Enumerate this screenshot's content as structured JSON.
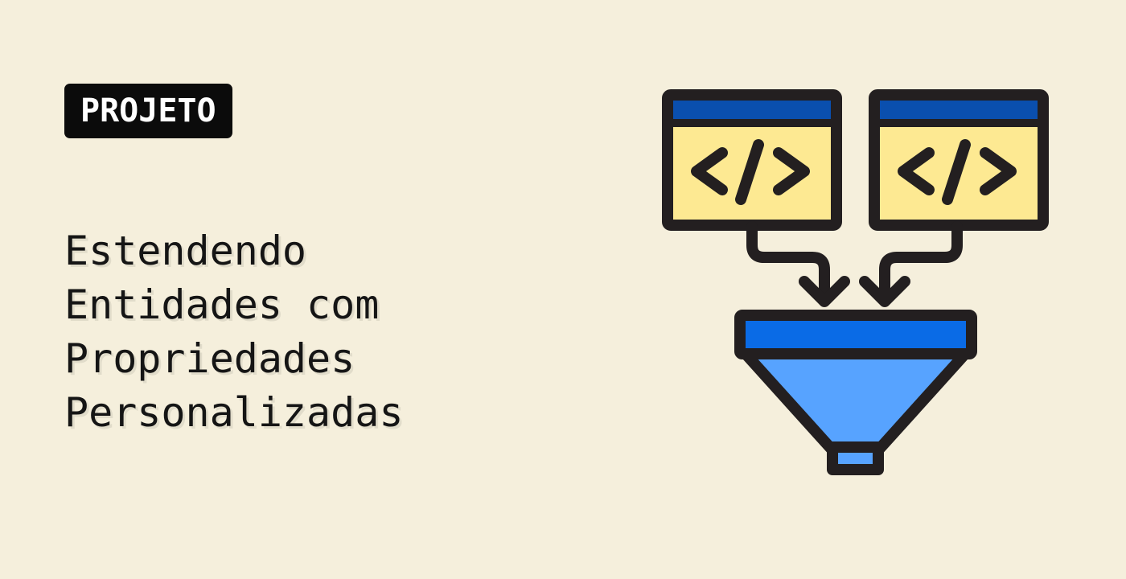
{
  "badge": {
    "label": "PROJETO"
  },
  "title": {
    "lines": [
      "Estendendo",
      "Entidades com",
      "Propriedades",
      "Personalizadas"
    ]
  },
  "illustration": {
    "icon": "code-windows-funnel-icon",
    "colors": {
      "background": "#f5efdc",
      "outline": "#231f20",
      "window_bar": "#0a4fae",
      "window_body": "#fde992",
      "window_body_light": "#fff3b5",
      "funnel_rim": "#0a6be6",
      "funnel_body": "#57a3ff"
    }
  }
}
